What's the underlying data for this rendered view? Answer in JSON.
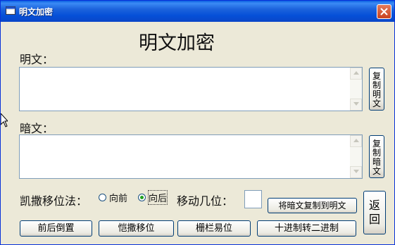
{
  "window": {
    "title": "明文加密"
  },
  "heading": "明文加密",
  "plaintext": {
    "label": "明文：",
    "value": "",
    "copy_label": "复制明文"
  },
  "ciphertext": {
    "label": "暗文：",
    "value": "",
    "copy_label": "复制暗文"
  },
  "caesar": {
    "label": "凯撒移位法：",
    "options": [
      {
        "label": "向前",
        "checked": false
      },
      {
        "label": "向后",
        "checked": true
      }
    ],
    "shift_label": "移动几位：",
    "shift_value": ""
  },
  "buttons": {
    "copy_cipher_to_plain": "将暗文复制到明文",
    "back": "返回",
    "reverse": "前后倒置",
    "caesar_shift": "恺撒移位",
    "rail_fence": "栅栏易位",
    "dec_to_bin": "十进制转二进制"
  }
}
